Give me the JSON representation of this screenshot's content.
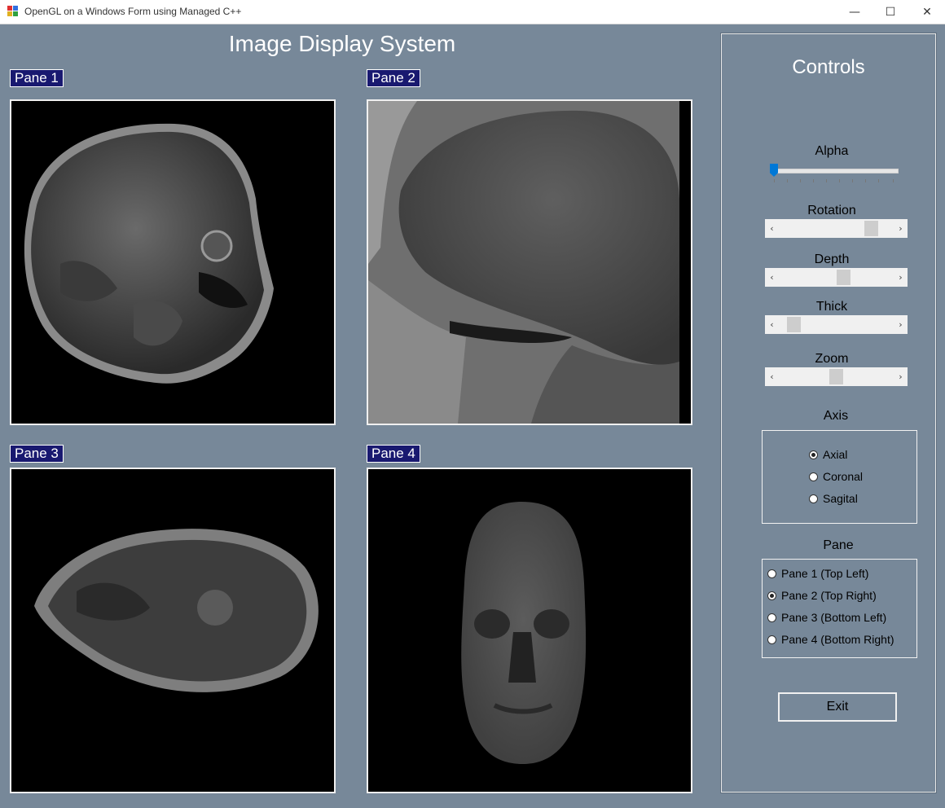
{
  "window": {
    "title": "OpenGL on a Windows Form using Managed C++",
    "minimize_glyph": "—",
    "maximize_glyph": "☐",
    "close_glyph": "✕"
  },
  "main": {
    "title": "Image Display System",
    "panes": [
      {
        "label": "Pane 1"
      },
      {
        "label": "Pane 2"
      },
      {
        "label": "Pane 3"
      },
      {
        "label": "Pane 4"
      }
    ]
  },
  "controls": {
    "title": "Controls",
    "alpha": {
      "label": "Alpha",
      "value_fraction": 0.0
    },
    "rotation": {
      "label": "Rotation",
      "value_fraction": 0.85
    },
    "depth": {
      "label": "Depth",
      "value_fraction": 0.57
    },
    "thick": {
      "label": "Thick",
      "value_fraction": 0.08
    },
    "zoom": {
      "label": "Zoom",
      "value_fraction": 0.5
    },
    "scroll_left_glyph": "‹",
    "scroll_right_glyph": "›",
    "axis": {
      "label": "Axis",
      "options": [
        "Axial",
        "Coronal",
        "Sagital"
      ],
      "selected": "Axial"
    },
    "pane": {
      "label": "Pane",
      "options": [
        "Pane 1 (Top Left)",
        "Pane 2 (Top Right)",
        "Pane 3 (Bottom Left)",
        "Pane 4 (Bottom Right)"
      ],
      "selected": "Pane 2 (Top Right)"
    },
    "exit_label": "Exit"
  },
  "colors": {
    "background": "#778899",
    "pane_label_bg": "#191970",
    "trackbar_thumb": "#0078d7"
  }
}
